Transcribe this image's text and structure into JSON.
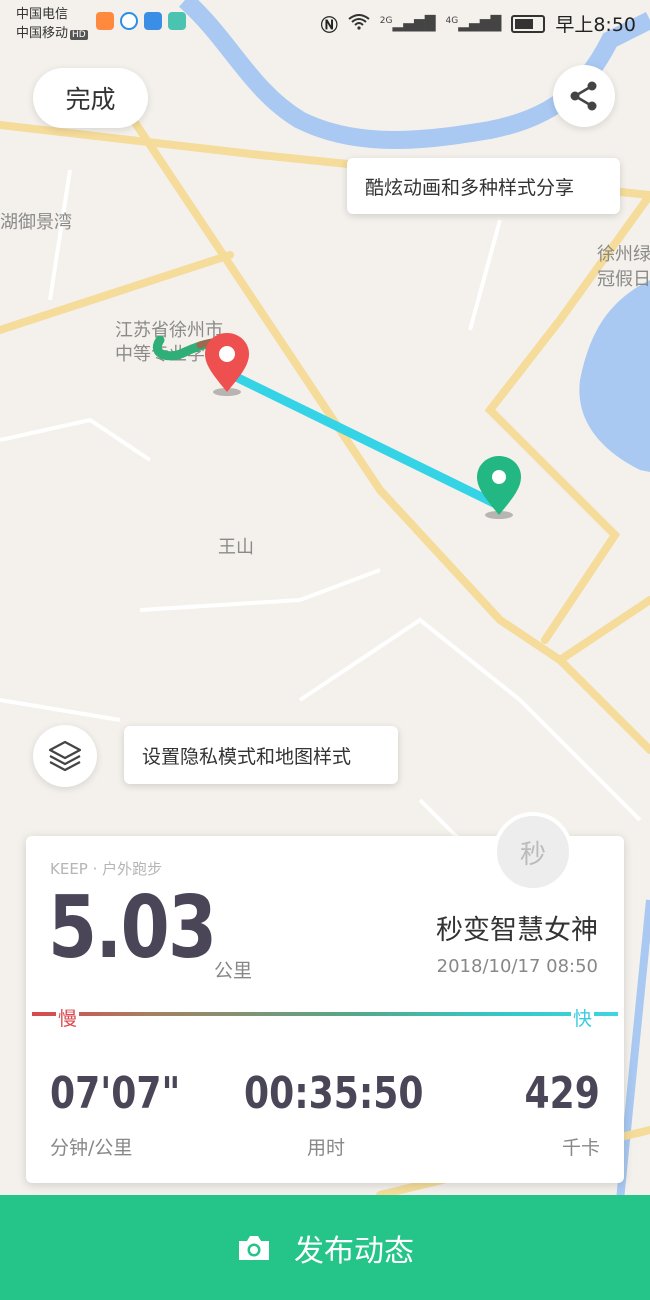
{
  "status_bar": {
    "carrier1": "中国电信",
    "carrier2": "中国移动",
    "hd": "HD",
    "network_2g": "2G",
    "network_4g": "4G",
    "time": "早上8:50"
  },
  "map": {
    "place_labels": [
      "湖御景湾",
      "徐州绿",
      "冠假日",
      "江苏省徐州市",
      "中等专业学校",
      "王山"
    ],
    "route_color": "#35d3e6",
    "start_marker_color": "#22b783",
    "end_marker_color": "#ee4f4f"
  },
  "top_bar": {
    "done_label": "完成",
    "share_icon": "share-icon"
  },
  "tips": {
    "share_tip": "酷炫动画和多种样式分享",
    "layer_tip": "设置隐私模式和地图样式"
  },
  "layer_button": {
    "icon": "layers-icon"
  },
  "summary_card": {
    "source": "KEEP · 户外跑步",
    "distance": "5.03",
    "distance_unit": "公里",
    "avatar_text": "秒",
    "username": "秒变智慧女神",
    "datetime": "2018/10/17 08:50",
    "slow_label": "慢",
    "fast_label": "快",
    "stats": [
      {
        "value": "07'07\"",
        "label": "分钟/公里"
      },
      {
        "value": "00:35:50",
        "label": "用时"
      },
      {
        "value": "429",
        "label": "千卡"
      }
    ]
  },
  "publish_button": {
    "label": "发布动态",
    "icon": "camera-icon",
    "color": "#25c489"
  }
}
